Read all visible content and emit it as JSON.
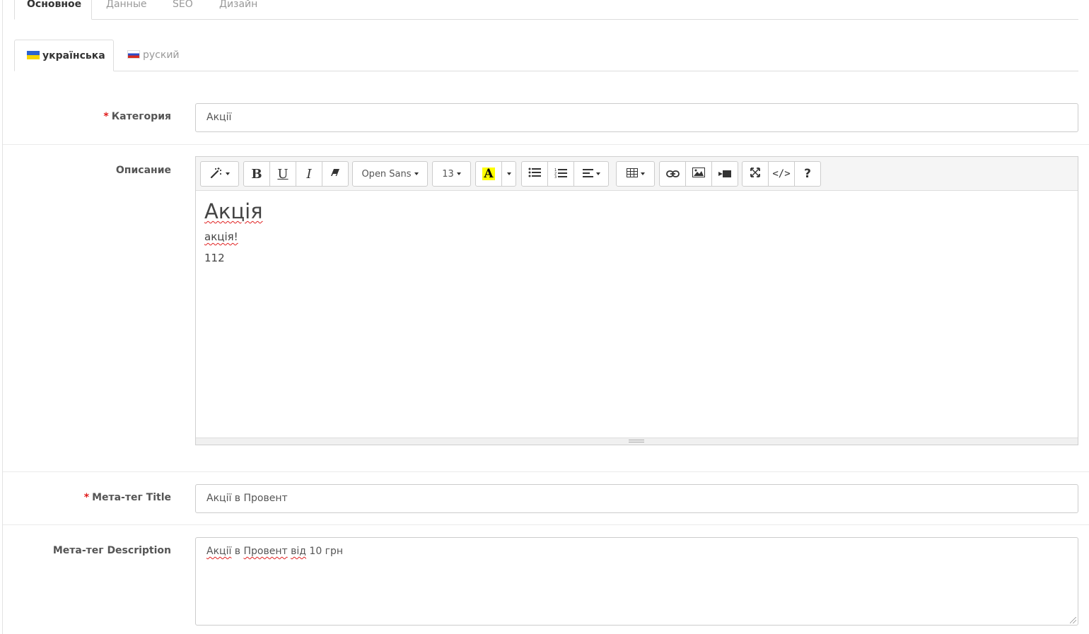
{
  "tabs": [
    "Основное",
    "Данные",
    "SEO",
    "Дизайн"
  ],
  "languages": [
    {
      "label": "українська",
      "flag": "ua-flag-icon"
    },
    {
      "label": "руский",
      "flag": "ru-flag-icon"
    }
  ],
  "category": {
    "label": "Категория",
    "value": "Акції"
  },
  "description": {
    "label": "Описание",
    "toolbar": {
      "font_name": "Open Sans",
      "font_size": "13",
      "color_letter": "A",
      "highlight_color": "#ffff00",
      "help": "?"
    },
    "content": {
      "heading": "Акція",
      "line1": "акція!",
      "line2": "112"
    }
  },
  "meta_title": {
    "label": "Мета-тег Title",
    "value": "Акції в Провент"
  },
  "meta_description": {
    "label": "Мета-тег Description",
    "value_words": [
      "Акції",
      "в",
      "Провент",
      "від",
      "10 грн"
    ]
  },
  "colors": {
    "required": "#e01b1b",
    "border": "#cccccc"
  }
}
